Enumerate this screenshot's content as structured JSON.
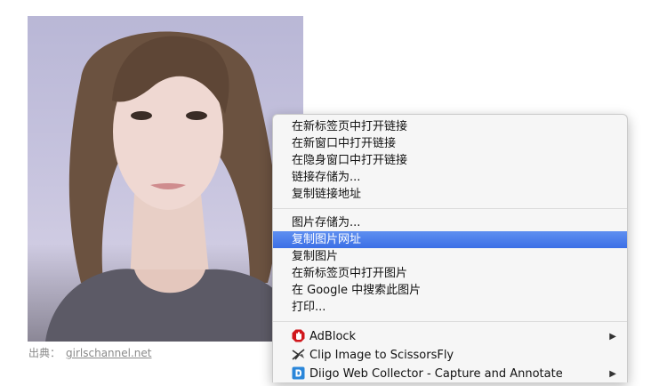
{
  "caption": {
    "label": "出典：",
    "link": "girlschannel.net"
  },
  "menu": {
    "link_group": [
      "在新标签页中打开链接",
      "在新窗口中打开链接",
      "在隐身窗口中打开链接",
      "链接存储为...",
      "复制链接地址"
    ],
    "image_group": [
      "图片存储为...",
      "复制图片网址",
      "复制图片",
      "在新标签页中打开图片",
      "在 Google 中搜索此图片",
      "打印..."
    ],
    "highlighted": "复制图片网址",
    "extensions": [
      {
        "label": "AdBlock",
        "icon": "adblock-icon",
        "submenu": true
      },
      {
        "label": "Clip Image to ScissorsFly",
        "icon": "scissors-icon",
        "submenu": false
      },
      {
        "label": "Diigo Web Collector - Capture and Annotate",
        "icon": "diigo-icon",
        "submenu": true
      }
    ],
    "submenu_arrow": "▶"
  },
  "colors": {
    "highlight": "#3b6fe6",
    "adblock": "#d0161b",
    "diigo": "#2a86d9"
  }
}
